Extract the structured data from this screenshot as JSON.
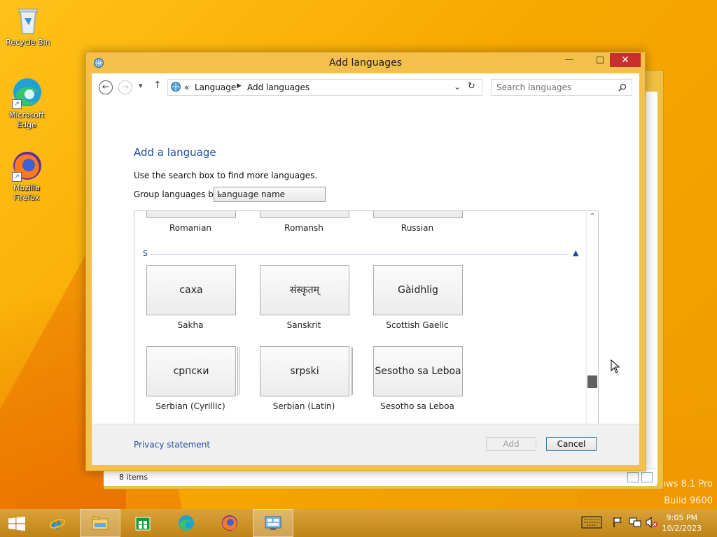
{
  "desktop": {
    "icons": [
      {
        "label_line1": "Recycle Bin",
        "label_line2": ""
      },
      {
        "label_line1": "Microsoft",
        "label_line2": "Edge"
      },
      {
        "label_line1": "Mozilla",
        "label_line2": "Firefox"
      }
    ],
    "watermark_line1": "ows 8.1 Pro",
    "watermark_line2": "Build 9600"
  },
  "background_window": {
    "status_text": "8 items"
  },
  "dialog": {
    "title": "Add languages",
    "address": {
      "overflow": "«",
      "crumbs": [
        "Language",
        "Add languages"
      ]
    },
    "search": {
      "placeholder": "Search languages"
    },
    "heading": "Add a language",
    "description": "Use the search box to find more languages.",
    "group_label": "Group languages by:",
    "group_value": "Language name",
    "section_letter": "S",
    "top_row": [
      "Romanian",
      "Romansh",
      "Russian"
    ],
    "tiles_row1": [
      {
        "native": "саха",
        "name": "Sakha"
      },
      {
        "native": "संस्कृतम्",
        "name": "Sanskrit"
      },
      {
        "native": "Gàidhlig",
        "name": "Scottish Gaelic"
      }
    ],
    "tiles_row2": [
      {
        "native": "српски",
        "name": "Serbian (Cyrillic)"
      },
      {
        "native": "srpski",
        "name": "Serbian (Latin)"
      },
      {
        "native": "Sesotho sa Leboa",
        "name": "Sesotho sa Leboa"
      }
    ],
    "scroll_position": 0.78,
    "footer": {
      "privacy": "Privacy statement",
      "add": "Add",
      "cancel": "Cancel"
    }
  },
  "taskbar": {
    "clock_time": "9:05 PM",
    "clock_date": "10/2/2023",
    "colors": {
      "accent": "#1e4f9e",
      "close": "#c7302c"
    }
  }
}
